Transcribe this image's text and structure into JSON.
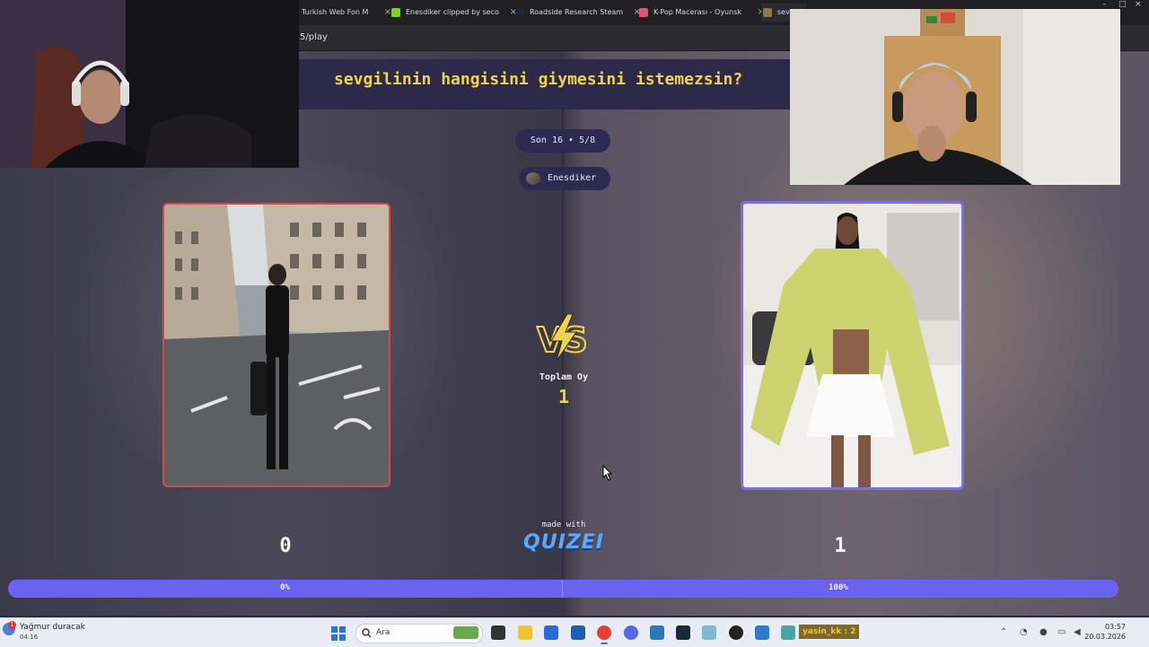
{
  "browser": {
    "tabs": [
      {
        "label": "Turkish Web Fon M",
        "favicon_color": "#2b2b31"
      },
      {
        "label": "Enesdiker clipped by seco",
        "favicon_color": "#7ed321"
      },
      {
        "label": "Roadside Research Steam",
        "favicon_color": "#1b2838"
      },
      {
        "label": "K-Pop Macerası - Oyunsk",
        "favicon_color": "#e0556e"
      },
      {
        "label": "sev",
        "favicon_color": "#8a7a44"
      }
    ],
    "tab_close_glyph": "×",
    "address": "5/play",
    "window_controls": [
      "–",
      "□",
      "×"
    ]
  },
  "quiz": {
    "question": "sevgilinin hangisini giymesini istemezsin?",
    "round": "Son 16 • 5/8",
    "creator": "Enesdiker",
    "total_label": "Toplam Oy",
    "total_value": "1",
    "made_with": "made with",
    "brand": "QUIZEI",
    "left_score": "0",
    "right_score": "1",
    "left_percent": "0%",
    "right_percent": "100%",
    "left_fraction": 0.0,
    "right_fraction": 1.0,
    "accent_yellow": "#f2d44c",
    "accent_purple": "#6a62f0",
    "left_border": "#d84848",
    "right_border": "#7c6cf2"
  },
  "taskbar": {
    "weather_badge": "1",
    "weather_text": "Yağmur duracak",
    "weather_time": "04:16",
    "search_placeholder": "Ara",
    "chat_label": "yasin_kk : 2",
    "clock": "03:57",
    "date": "20.03.2026"
  }
}
